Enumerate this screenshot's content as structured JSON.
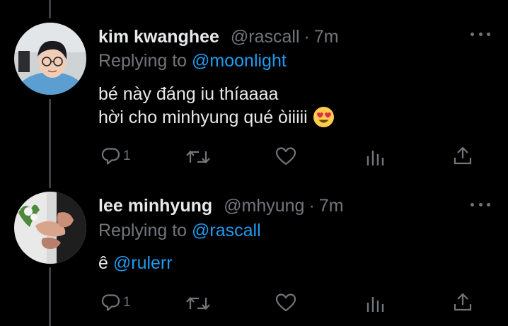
{
  "colors": {
    "background": "#000000",
    "text_primary": "#e7e9ea",
    "text_secondary": "#71767b",
    "accent_link": "#1d9bf0",
    "thread_line": "#3e4144"
  },
  "tweets": [
    {
      "display_name": "kim kwanghee",
      "handle": "@rascall",
      "separator": "·",
      "time": "7m",
      "replying_prefix": "Replying to",
      "replying_to": "@moonlight",
      "lines": [
        "bé này đáng iu thíaaaa",
        "hời cho minhyung qué òiiiii"
      ],
      "emoji": "😍",
      "actions": {
        "reply_count": "1"
      },
      "icons": [
        "more-icon",
        "reply-icon",
        "retweet-icon",
        "like-icon",
        "analytics-icon",
        "share-icon"
      ]
    },
    {
      "display_name": "lee minhyung",
      "handle": "@mhyung",
      "separator": "·",
      "time": "7m",
      "replying_prefix": "Replying to",
      "replying_to": "@rascall",
      "body_prefix": "ê",
      "body_mention": "@rulerr",
      "actions": {
        "reply_count": "1"
      },
      "icons": [
        "more-icon",
        "reply-icon",
        "retweet-icon",
        "like-icon",
        "analytics-icon",
        "share-icon"
      ]
    }
  ]
}
